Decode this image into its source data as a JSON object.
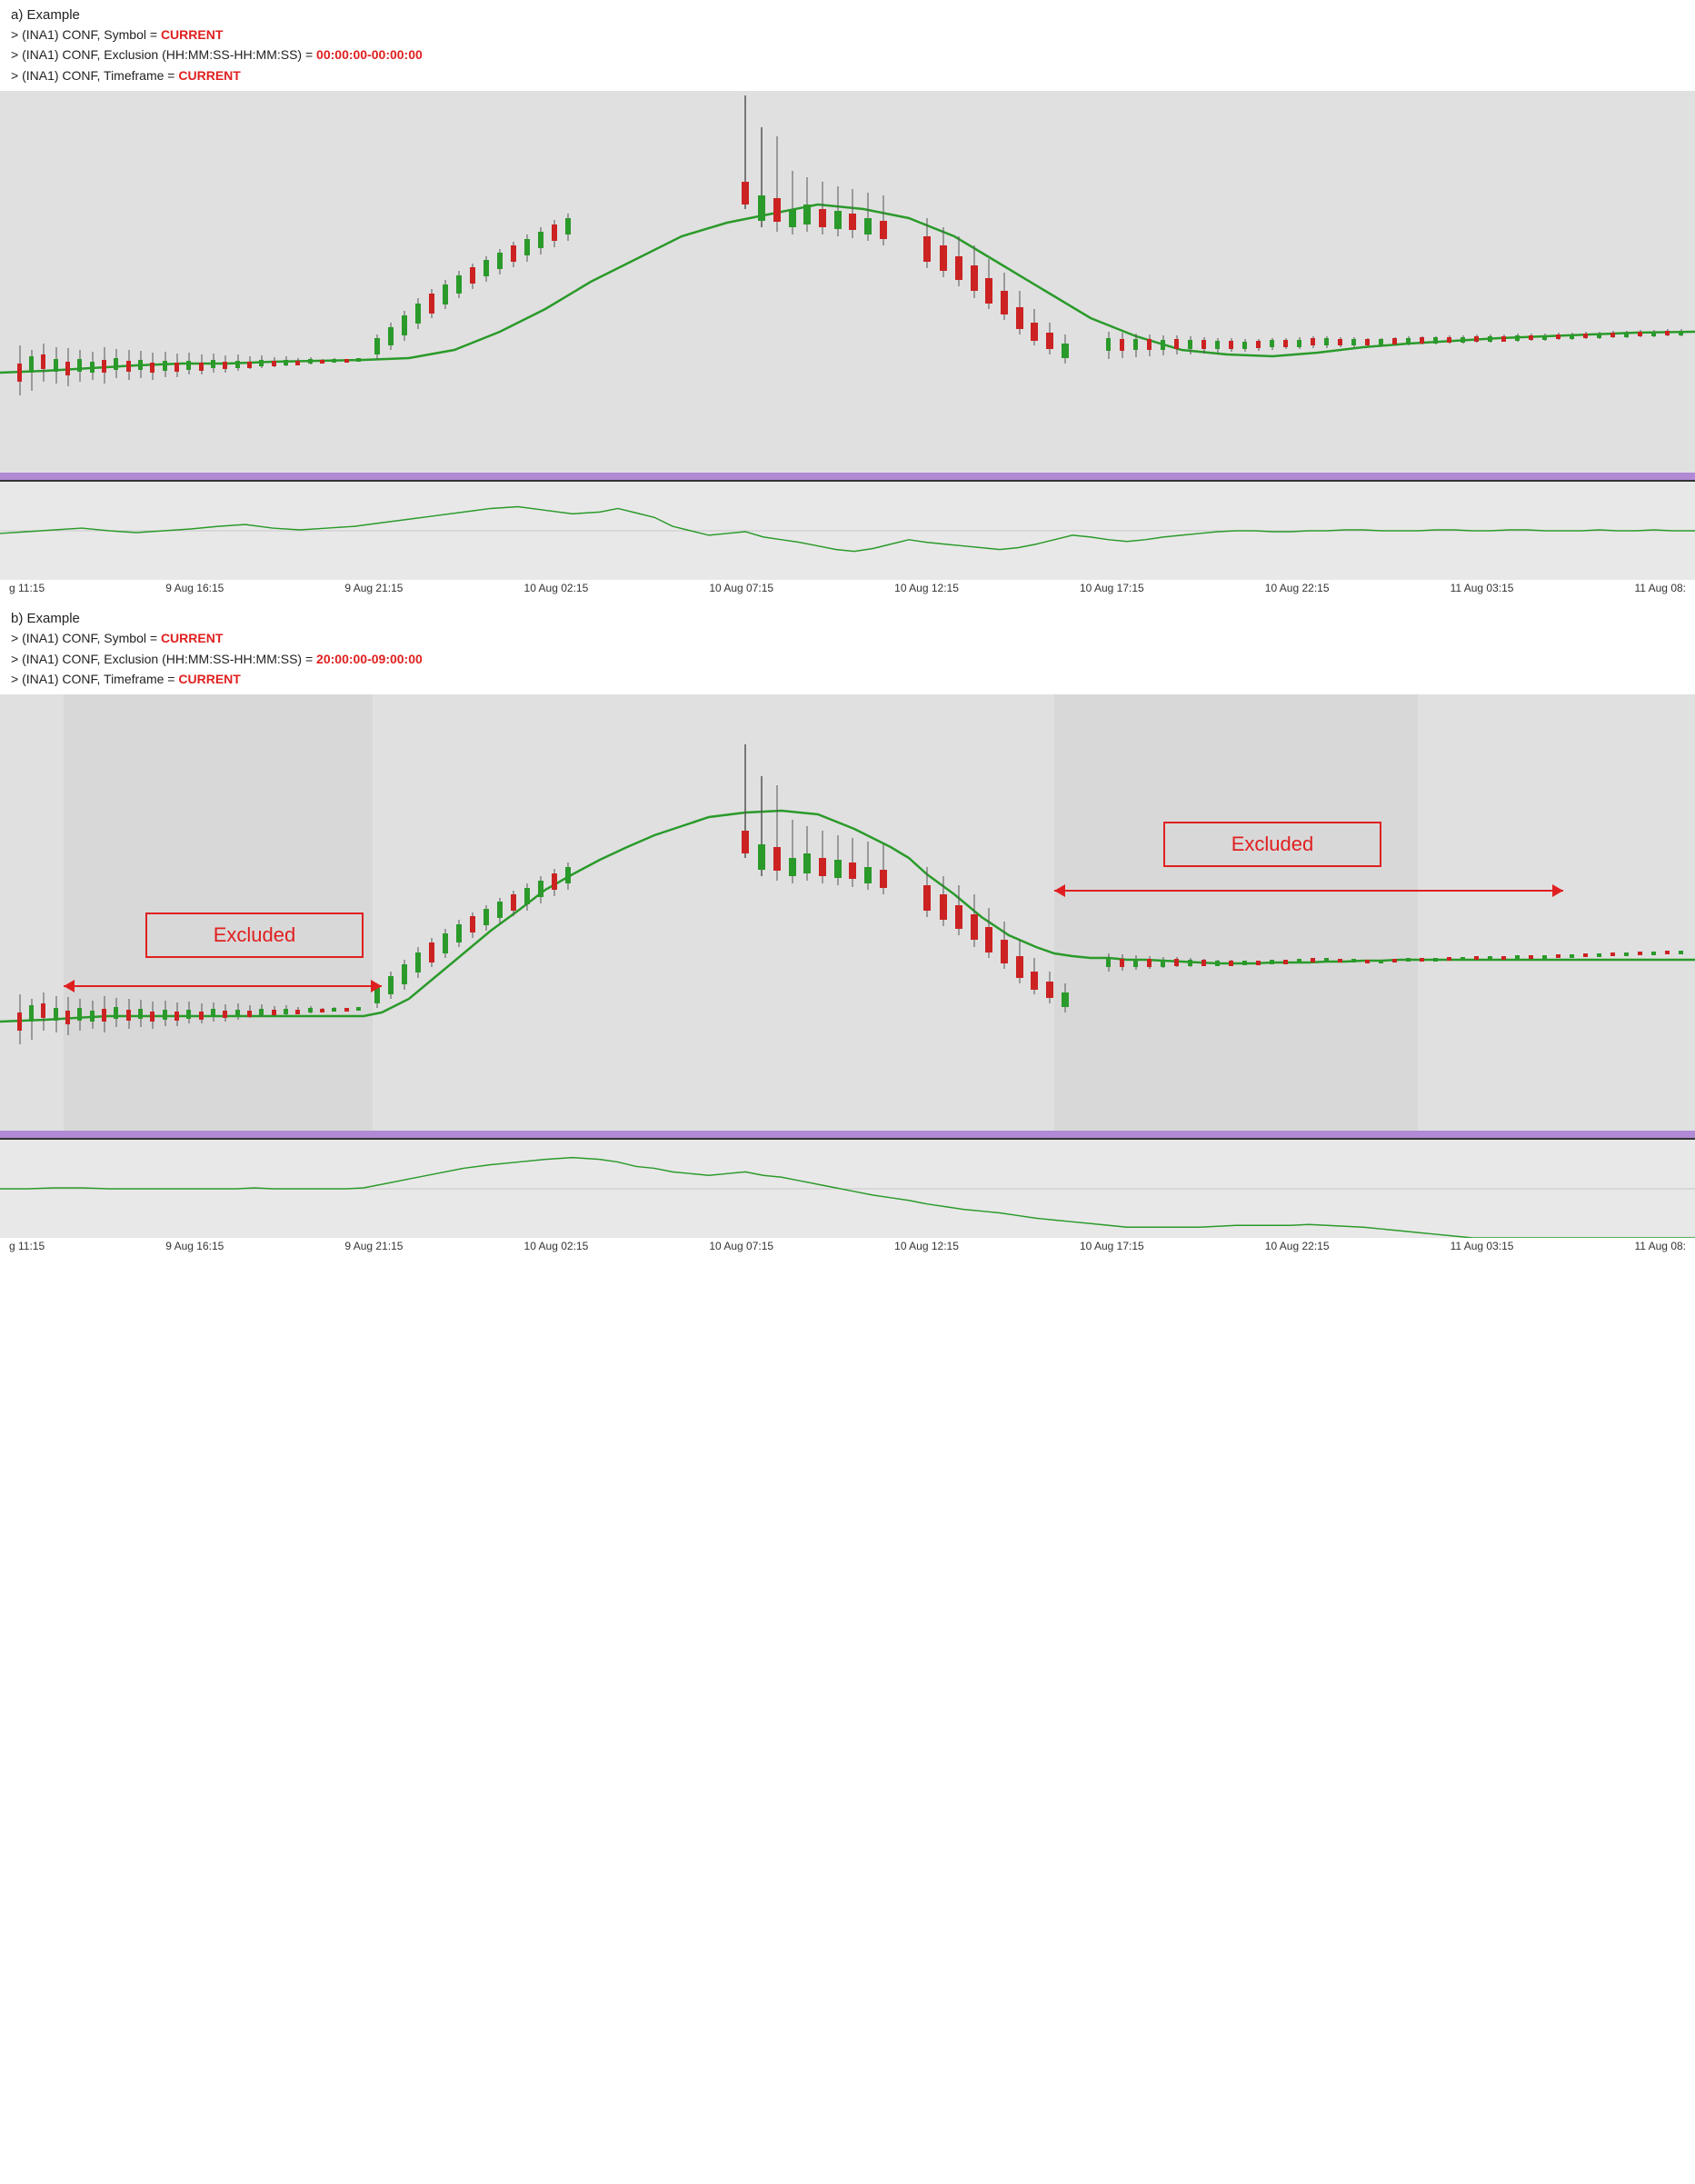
{
  "sectionA": {
    "label": "a) Example",
    "lines": [
      "> (INA1) CONF, Symbol = ",
      "> (INA1) CONF, Exclusion (HH:MM:SS-HH:MM:SS) = ",
      "> (INA1) CONF, Timeframe = "
    ],
    "values": [
      "CURRENT",
      "00:00:00-00:00:00",
      "CURRENT"
    ]
  },
  "sectionB": {
    "label": "b) Example",
    "lines": [
      "> (INA1) CONF, Symbol = ",
      "> (INA1) CONF, Exclusion (HH:MM:SS-HH:MM:SS) = ",
      "> (INA1) CONF, Timeframe = "
    ],
    "values": [
      "CURRENT",
      "20:00:00-09:00:00",
      "CURRENT"
    ]
  },
  "timeAxis": {
    "labels": [
      "g 11:15",
      "9 Aug 16:15",
      "9 Aug 21:15",
      "10 Aug 02:15",
      "10 Aug 07:15",
      "10 Aug 12:15",
      "10 Aug 17:15",
      "10 Aug 22:15",
      "11 Aug 03:15",
      "11 Aug 08:"
    ]
  },
  "excluded": "Excluded"
}
